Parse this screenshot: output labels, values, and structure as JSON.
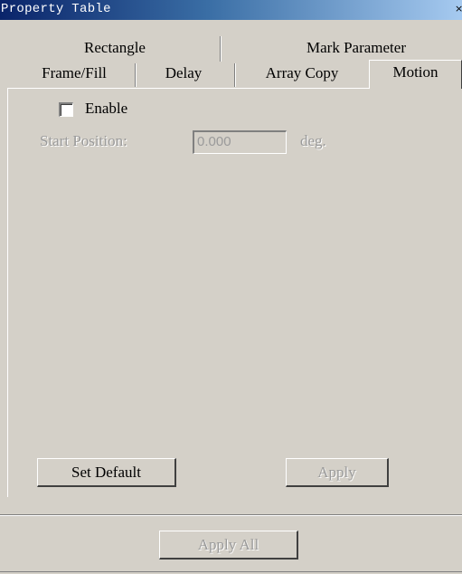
{
  "window": {
    "title": "Property Table",
    "close_glyph": "×"
  },
  "tabs": {
    "row1": [
      {
        "label": "Rectangle"
      },
      {
        "label": "Mark Parameter"
      }
    ],
    "row2": [
      {
        "label": "Frame/Fill"
      },
      {
        "label": "Delay"
      },
      {
        "label": "Array Copy"
      },
      {
        "label": "Motion",
        "active": true
      }
    ]
  },
  "motion": {
    "enable_label": "Enable",
    "enable_checked": false,
    "start_position_label": "Start Position:",
    "start_position_value": "0.000",
    "start_position_unit": "deg."
  },
  "buttons": {
    "set_default": "Set Default",
    "apply": "Apply",
    "apply_all": "Apply All"
  },
  "colors": {
    "face": "#d4d0c8",
    "title_start": "#0a246a",
    "title_end": "#a6caf0",
    "disabled_text": "#9a9a9a"
  }
}
